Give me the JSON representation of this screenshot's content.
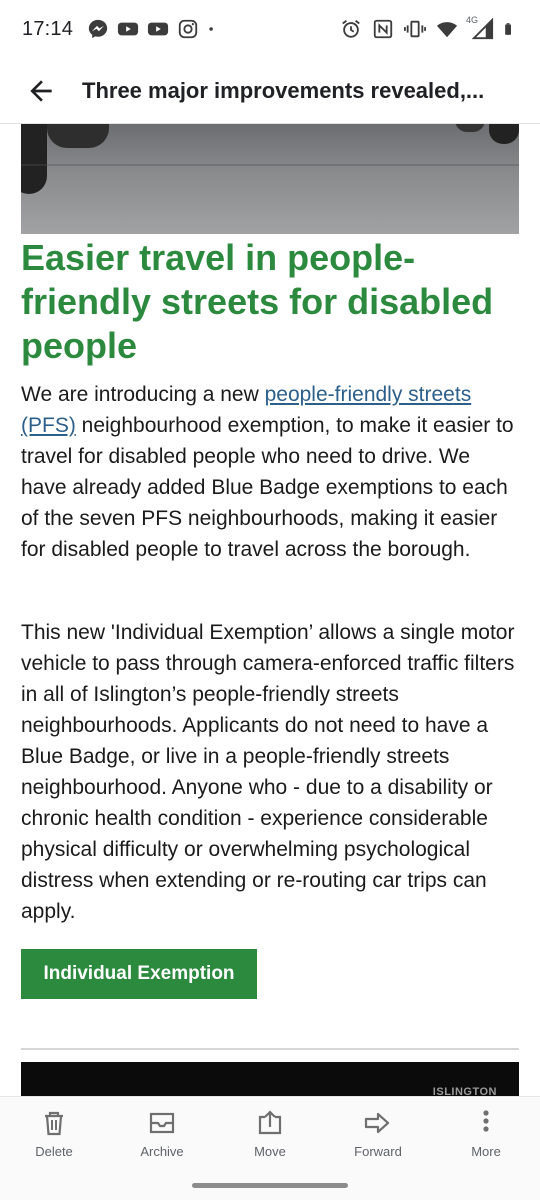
{
  "status_bar": {
    "time": "17:14",
    "left_icons": [
      "messenger-icon",
      "youtube-icon",
      "youtube-icon",
      "instagram-icon",
      "dot-icon"
    ],
    "right_icons": [
      "alarm-icon",
      "nfc-icon",
      "vibrate-icon",
      "wifi-icon",
      "signal-icon",
      "battery-icon"
    ],
    "network": "4G"
  },
  "app_bar": {
    "title": "Three major improvements revealed,..."
  },
  "article": {
    "heading": "Easier travel in people-friendly streets for disabled people",
    "para1_before": "We are introducing a new ",
    "para1_link": "people-friendly streets (PFS)",
    "para1_after": " neighbourhood exemption, to make it easier to travel for disabled people who need to drive. We have already added Blue Badge exemptions to each of the seven PFS neighbourhoods, making it easier for disabled people to travel across the borough.",
    "para2": "This new 'Individual Exemption’ allows a single motor vehicle to pass through camera-enforced traffic filters in all of Islington’s people-friendly streets neighbourhoods. Applicants do not need to have a Blue Badge, or live in a people-friendly streets neighbourhood. Anyone who  - due to a disability or chronic health condition - experience considerable physical difficulty or overwhelming psychological distress when extending or re-routing car trips can apply.",
    "button_label": "Individual Exemption",
    "video_label": "ISLINGTON"
  },
  "bottom_actions": [
    {
      "label": "Delete",
      "icon": "trash-icon"
    },
    {
      "label": "Archive",
      "icon": "archive-icon"
    },
    {
      "label": "Move",
      "icon": "move-icon"
    },
    {
      "label": "Forward",
      "icon": "forward-icon"
    },
    {
      "label": "More",
      "icon": "more-vertical-icon"
    }
  ],
  "colors": {
    "heading_green": "#2b8a3e",
    "link_blue": "#2c5f8a",
    "button_green": "#2b8a3e"
  }
}
